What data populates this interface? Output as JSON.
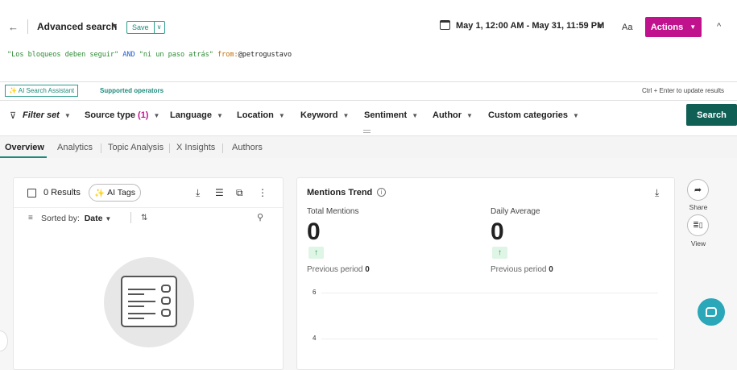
{
  "header": {
    "back_icon": "arrow-left-icon",
    "title": "Advanced search",
    "save_label": "Save",
    "date_range": "May 1, 12:00 AM - May 31, 11:59 PM",
    "font_toggle": "Aa",
    "actions_label": "Actions"
  },
  "query": {
    "part1": "\"Los bloqueos deben seguir\"",
    "op": " AND ",
    "part2": "\"ni un paso atrás\"",
    "space": " ",
    "from_key": "from:",
    "from_val": "@petrogustavo"
  },
  "assist": {
    "ai_label": "AI Search Assistant",
    "supported_label": "Supported operators",
    "ctrl_hint": "Ctrl + Enter to update results"
  },
  "filters": {
    "filter_set": "Filter set",
    "source_type": "Source type",
    "source_count": "(1)",
    "language": "Language",
    "location": "Location",
    "keyword": "Keyword",
    "sentiment": "Sentiment",
    "author": "Author",
    "custom": "Custom categories",
    "search_label": "Search"
  },
  "tabs": [
    {
      "label": "Overview"
    },
    {
      "label": "Analytics"
    },
    {
      "label": "Topic Analysis"
    },
    {
      "label": "X Insights"
    },
    {
      "label": "Authors"
    }
  ],
  "results": {
    "count_label": "0 Results",
    "ai_tags_label": "AI Tags",
    "sorted_by_label": "Sorted by:",
    "sorted_by_value": "Date"
  },
  "mentions": {
    "title": "Mentions Trend",
    "total_label": "Total Mentions",
    "total_value": "0",
    "total_prev_label": "Previous period",
    "total_prev_value": "0",
    "daily_label": "Daily Average",
    "daily_value": "0",
    "daily_prev_label": "Previous period",
    "daily_prev_value": "0",
    "y_ticks": [
      "6",
      "4"
    ]
  },
  "rail": {
    "share_label": "Share",
    "view_label": "View"
  },
  "colors": {
    "accent": "#c0128c",
    "teal": "#1d8a7c",
    "search_bg": "#0f5f55"
  }
}
